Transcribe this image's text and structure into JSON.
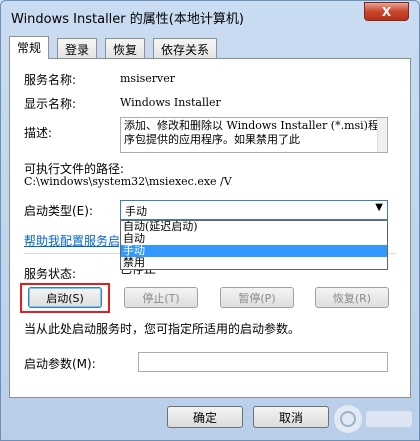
{
  "window": {
    "title": "Windows Installer 的属性(本地计算机)",
    "close_glyph": "X"
  },
  "tabs": [
    {
      "label": "常规",
      "active": true
    },
    {
      "label": "登录",
      "active": false
    },
    {
      "label": "恢复",
      "active": false
    },
    {
      "label": "依存关系",
      "active": false
    }
  ],
  "general": {
    "service_name_label": "服务名称:",
    "service_name_value": "msiserver",
    "display_name_label": "显示名称:",
    "display_name_value": "Windows Installer",
    "description_label": "描述:",
    "description_value": "添加、修改和删除以 Windows Installer (*.msi)程序包提供的应用程序。如果禁用了此",
    "path_label": "可执行文件的路径:",
    "path_value": "C:\\windows\\system32\\msiexec.exe /V",
    "startup_type_label": "启动类型(E):",
    "startup_type_value": "手动",
    "startup_type_options": [
      "自动(延迟启动)",
      "自动",
      "手动",
      "禁用"
    ],
    "startup_type_selected_index": 2,
    "help_link": "帮助我配置服务启动选项。",
    "status_label": "服务状态:",
    "status_value": "已停止",
    "buttons": {
      "start": "启动(S)",
      "stop": "停止(T)",
      "pause": "暂停(P)",
      "resume": "恢复(R)"
    },
    "hint_text": "当从此处启动服务时，您可指定所适用的启动参数。",
    "params_label": "启动参数(M):",
    "params_value": ""
  },
  "footer": {
    "ok_label": "确定",
    "cancel_label": "取消"
  },
  "watermark_icon": "logo-watermark-icon",
  "colors": {
    "highlight_border": "#e02020",
    "selection": "#3399ff",
    "link": "#0066cc"
  }
}
